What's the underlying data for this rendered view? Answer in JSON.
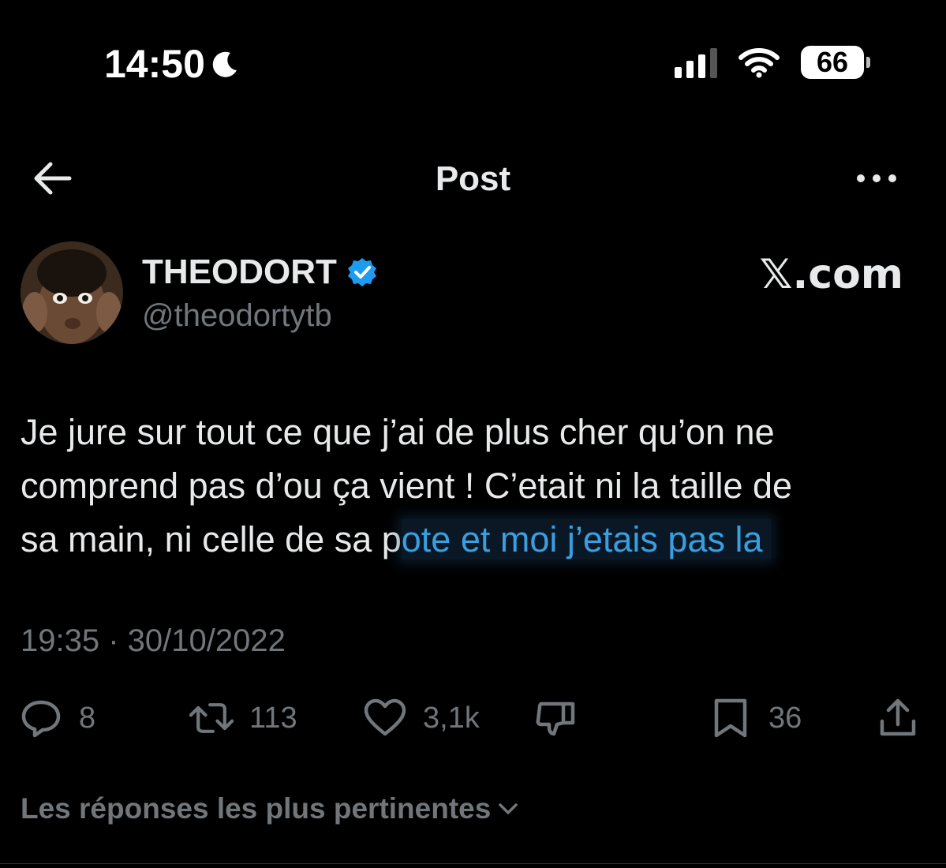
{
  "status_bar": {
    "time": "14:50",
    "battery": "66",
    "icons": [
      "moon-icon",
      "signal-icon",
      "wifi-icon",
      "battery-icon"
    ]
  },
  "header": {
    "title": "Post",
    "icons": [
      "back-arrow-icon",
      "more-options-icon"
    ]
  },
  "author": {
    "name": "THEODORT",
    "handle": "@theodortytb",
    "verified": true,
    "verified_color": "#1d9bf0"
  },
  "watermark": "𝕏.com",
  "tweet": {
    "line1": "Je jure sur tout ce que j’ai de plus cher qu’on ne",
    "line2": "comprend pas d’ou ça vient ! C’etait ni la taille de",
    "line3_plain": "sa main, ni celle de sa p",
    "line3_highlight": "ote et moi j’etais pas la",
    "highlight_color": "#3a9fe0",
    "timestamp": "19:35 · 30/10/2022"
  },
  "actions": {
    "replies": "8",
    "reposts": "113",
    "likes": "3,1k",
    "bookmarks": "36",
    "icons": [
      "reply-icon",
      "repost-icon",
      "like-icon",
      "dislike-icon",
      "bookmark-icon",
      "share-icon"
    ]
  },
  "replies_filter": {
    "label": "Les réponses les plus pertinentes"
  },
  "colors": {
    "background": "#000000",
    "text": "#e7e9ea",
    "secondary": "#71767b"
  }
}
